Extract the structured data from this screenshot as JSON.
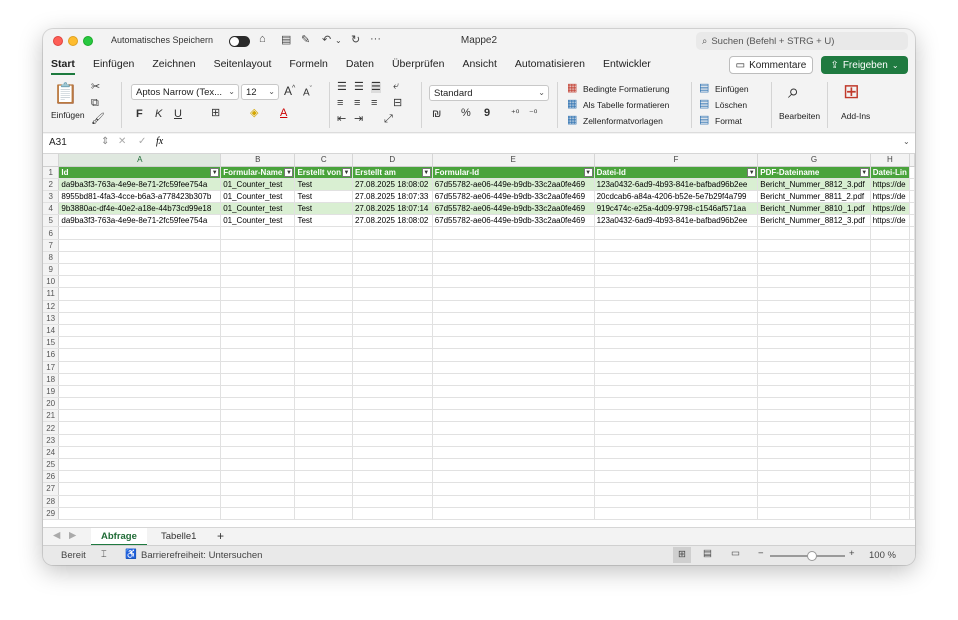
{
  "titlebar": {
    "autosave_label": "Automatisches Speichern",
    "document_title": "Mappe2",
    "search_placeholder": "Suchen (Befehl + STRG + U)"
  },
  "ribbon_tabs": [
    "Start",
    "Einfügen",
    "Zeichnen",
    "Seitenlayout",
    "Formeln",
    "Daten",
    "Überprüfen",
    "Ansicht",
    "Automatisieren",
    "Entwickler"
  ],
  "actions": {
    "comments": "Kommentare",
    "share": "Freigeben"
  },
  "ribbon": {
    "paste_label": "Einfügen",
    "font_name": "Aptos Narrow (Tex...",
    "font_size": "12",
    "number_format": "Standard",
    "bold": "F",
    "italic": "K",
    "underline": "U",
    "percent": "%",
    "thousands": "9",
    "cond_format": "Bedingte Formatierung",
    "as_table": "Als Tabelle formatieren",
    "cell_styles": "Zellenformatvorlagen",
    "insert": "Einfügen",
    "delete": "Löschen",
    "format": "Format",
    "edit": "Bearbeiten",
    "addins": "Add-Ins"
  },
  "formula_bar": {
    "name_box": "A31",
    "fx": "fx",
    "value": ""
  },
  "grid": {
    "columns": [
      "A",
      "B",
      "C",
      "D",
      "E",
      "F",
      "G",
      "H"
    ],
    "selected_column": "A",
    "headers": [
      "Id",
      "Formular-Name",
      "Erstellt von",
      "Erstellt am",
      "Formular-Id",
      "Datei-Id",
      "PDF-Dateiname",
      "Datei-Lin"
    ],
    "rows": [
      [
        "da9ba3f3-763a-4e9e-8e71-2fc59fee754a",
        "01_Counter_test",
        "Test",
        "27.08.2025 18:08:02",
        "67d55782-ae06-449e-b9db-33c2aa0fe469",
        "123a0432-6ad9-4b93-841e-bafbad96b2ee",
        "Bericht_Nummer_8812_3.pdf",
        "https://de"
      ],
      [
        "8955bd81-4fa3-4cce-b6a3-a778423b307b",
        "01_Counter_test",
        "Test",
        "27.08.2025 18:07:33",
        "67d55782-ae06-449e-b9db-33c2aa0fe469",
        "20cdcab6-a84a-4206-b52e-5e7b29f4a799",
        "Bericht_Nummer_8811_2.pdf",
        "https://de"
      ],
      [
        "9b3880ac-df4e-40e2-a18e-44b73cd99e18",
        "01_Counter_test",
        "Test",
        "27.08.2025 18:07:14",
        "67d55782-ae06-449e-b9db-33c2aa0fe469",
        "919c474c-e25a-4d09-9798-c1546af571aa",
        "Bericht_Nummer_8810_1.pdf",
        "https://de"
      ],
      [
        "da9ba3f3-763a-4e9e-8e71-2fc59fee754a",
        "01_Counter_test",
        "Test",
        "27.08.2025 18:08:02",
        "67d55782-ae06-449e-b9db-33c2aa0fe469",
        "123a0432-6ad9-4b93-841e-bafbad96b2ee",
        "Bericht_Nummer_8812_3.pdf",
        "https://de"
      ]
    ],
    "row_numbers": [
      "1",
      "2",
      "3",
      "4",
      "5",
      "6",
      "7",
      "8",
      "9",
      "10",
      "11",
      "12",
      "13",
      "14",
      "15",
      "16",
      "17",
      "18",
      "19",
      "20",
      "21",
      "22",
      "23",
      "24",
      "25",
      "26",
      "27",
      "28",
      "29"
    ]
  },
  "sheets": [
    "Abfrage",
    "Tabelle1"
  ],
  "active_sheet": "Abfrage",
  "add_sheet": "+",
  "status": {
    "ready": "Bereit",
    "accessibility": "Barrierefreiheit: Untersuchen",
    "zoom": "100 %"
  },
  "colors": {
    "accent": "#1f7a40",
    "header_fill": "#4aa33c",
    "band_fill": "#d9efd2"
  }
}
